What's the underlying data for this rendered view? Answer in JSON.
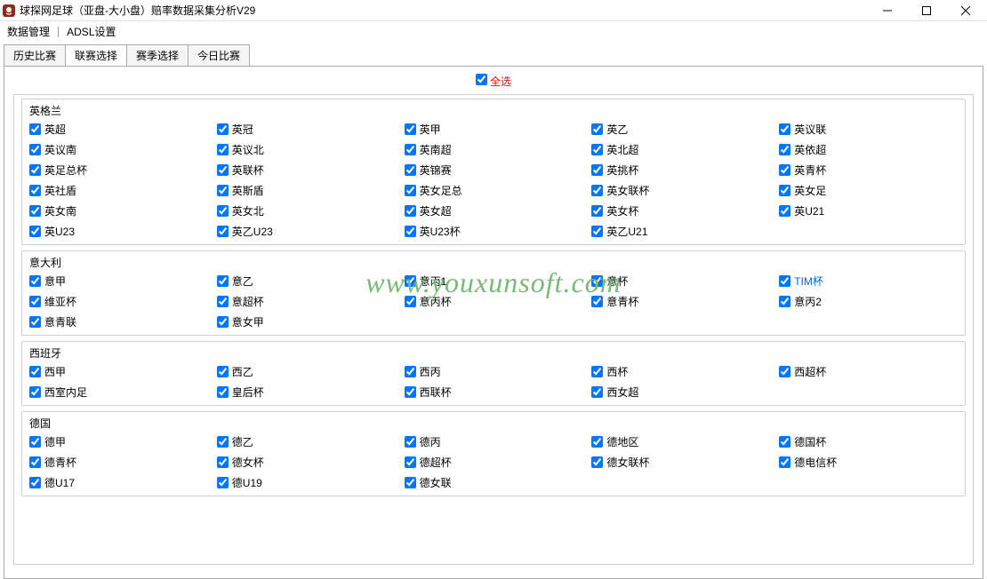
{
  "window": {
    "title": "球探网足球（亚盘-大小盘）赔率数据采集分析V29"
  },
  "menu": {
    "data_mgmt": "数据管理",
    "adsl": "ADSL设置"
  },
  "tabs": [
    {
      "label": "历史比赛"
    },
    {
      "label": "联赛选择"
    },
    {
      "label": "赛季选择"
    },
    {
      "label": "今日比赛"
    }
  ],
  "selectall_label": "全选",
  "groups": [
    {
      "title": "英格兰",
      "items": [
        {
          "label": "英超"
        },
        {
          "label": "英冠"
        },
        {
          "label": "英甲"
        },
        {
          "label": "英乙"
        },
        {
          "label": "英议联"
        },
        {
          "label": "英议南"
        },
        {
          "label": "英议北"
        },
        {
          "label": "英南超"
        },
        {
          "label": "英北超"
        },
        {
          "label": "英依超"
        },
        {
          "label": "英足总杯"
        },
        {
          "label": "英联杯"
        },
        {
          "label": "英锦赛"
        },
        {
          "label": "英挑杯"
        },
        {
          "label": "英青杯"
        },
        {
          "label": "英社盾"
        },
        {
          "label": "英斯盾"
        },
        {
          "label": "英女足总"
        },
        {
          "label": "英女联杯"
        },
        {
          "label": "英女足"
        },
        {
          "label": "英女南"
        },
        {
          "label": "英女北"
        },
        {
          "label": "英女超"
        },
        {
          "label": "英女杯"
        },
        {
          "label": "英U21"
        },
        {
          "label": "英U23"
        },
        {
          "label": "英乙U23"
        },
        {
          "label": "英U23杯"
        },
        {
          "label": "英乙U21"
        }
      ]
    },
    {
      "title": "意大利",
      "items": [
        {
          "label": "意甲"
        },
        {
          "label": "意乙"
        },
        {
          "label": "意丙1"
        },
        {
          "label": "意杯"
        },
        {
          "label": "TIM杯",
          "highlight": true
        },
        {
          "label": "维亚杯"
        },
        {
          "label": "意超杯"
        },
        {
          "label": "意丙杯"
        },
        {
          "label": "意青杯"
        },
        {
          "label": "意丙2"
        },
        {
          "label": "意青联"
        },
        {
          "label": "意女甲"
        }
      ]
    },
    {
      "title": "西班牙",
      "items": [
        {
          "label": "西甲"
        },
        {
          "label": "西乙"
        },
        {
          "label": "西丙"
        },
        {
          "label": "西杯"
        },
        {
          "label": "西超杯"
        },
        {
          "label": "西室内足"
        },
        {
          "label": "皇后杯"
        },
        {
          "label": "西联杯"
        },
        {
          "label": "西女超"
        }
      ]
    },
    {
      "title": "德国",
      "items": [
        {
          "label": "德甲"
        },
        {
          "label": "德乙"
        },
        {
          "label": "德丙"
        },
        {
          "label": "德地区"
        },
        {
          "label": "德国杯"
        },
        {
          "label": "德青杯"
        },
        {
          "label": "德女杯"
        },
        {
          "label": "德超杯"
        },
        {
          "label": "德女联杯"
        },
        {
          "label": "德电信杯"
        },
        {
          "label": "德U17"
        },
        {
          "label": "德U19"
        },
        {
          "label": "德女联"
        }
      ]
    }
  ],
  "watermark": "www.youxunsoft.com"
}
